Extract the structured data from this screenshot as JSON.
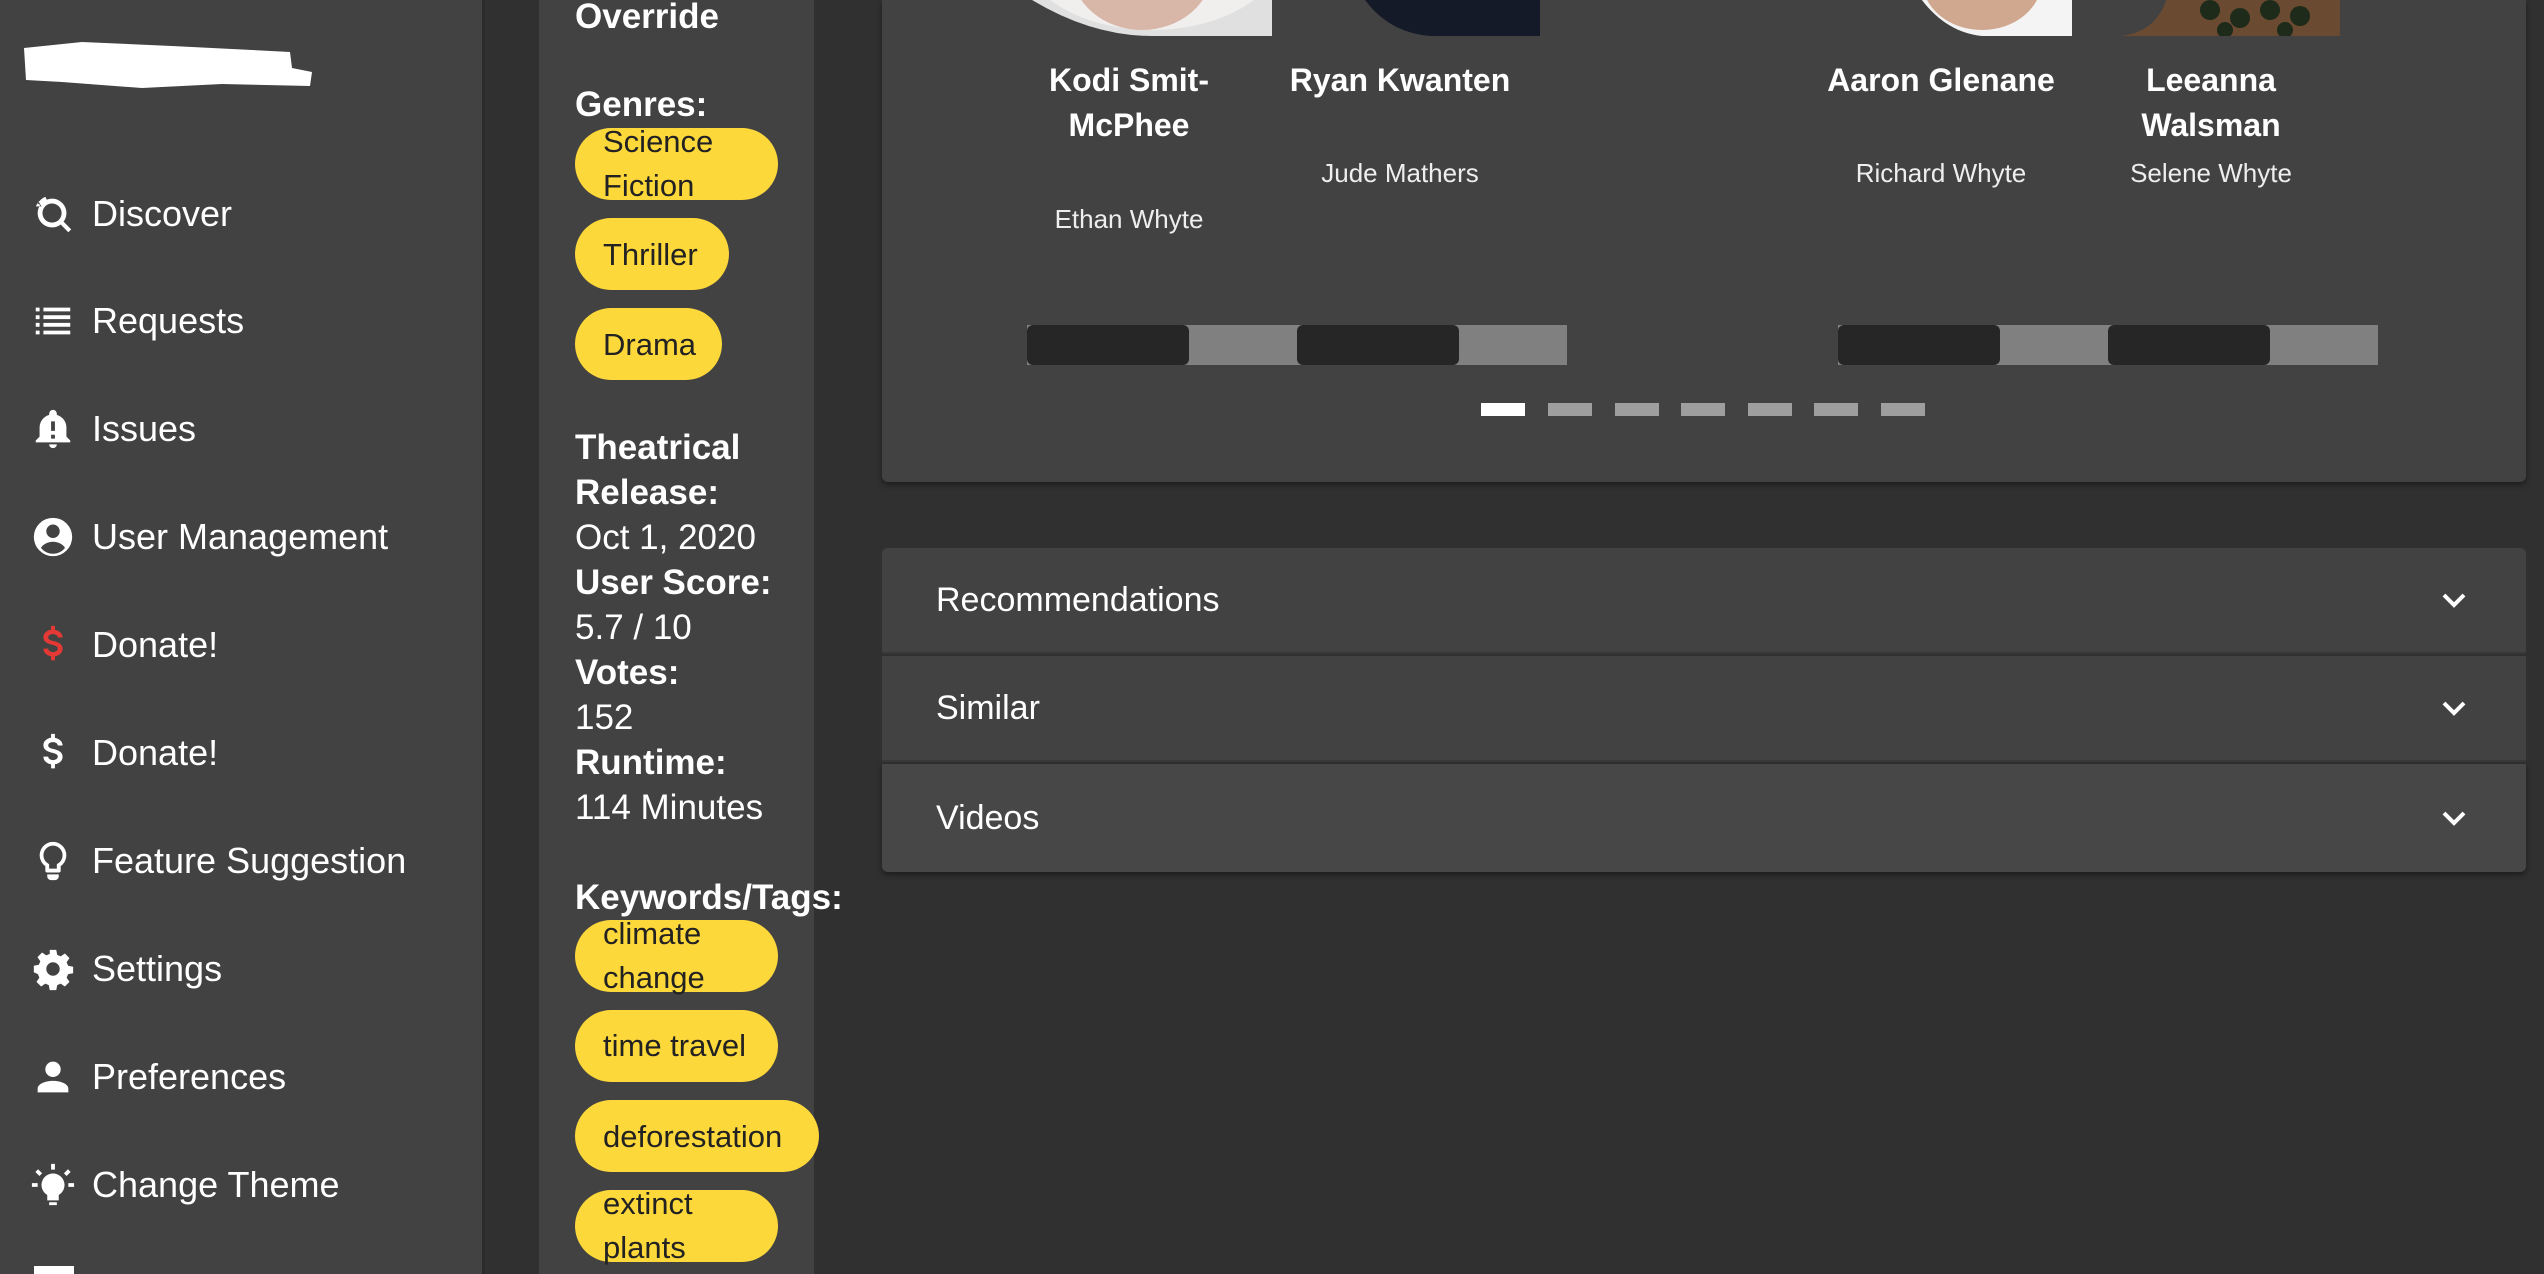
{
  "sidebar": {
    "items": [
      {
        "label": "Discover",
        "icon": "discover-icon"
      },
      {
        "label": "Requests",
        "icon": "list-icon"
      },
      {
        "label": "Issues",
        "icon": "bell-alert-icon"
      },
      {
        "label": "User Management",
        "icon": "account-circle-icon"
      },
      {
        "label": "Donate!",
        "icon": "dollar-icon",
        "color": "#e53935"
      },
      {
        "label": "Donate!",
        "icon": "dollar-icon",
        "color": "#ffffff"
      },
      {
        "label": "Feature Suggestion",
        "icon": "lightbulb-icon"
      },
      {
        "label": "Settings",
        "icon": "gear-icon"
      },
      {
        "label": "Preferences",
        "icon": "person-icon"
      },
      {
        "label": "Change Theme",
        "icon": "theme-icon"
      }
    ]
  },
  "info": {
    "override_label": "Override",
    "genres_label": "Genres:",
    "genres": [
      "Science Fiction",
      "Thriller",
      "Drama"
    ],
    "release_label": "Theatrical Release:",
    "release_value": "Oct 1, 2020",
    "score_label": "User Score:",
    "score_value": "5.7 / 10",
    "votes_label": "Votes:",
    "votes_value": "152",
    "runtime_label": "Runtime:",
    "runtime_value": "114 Minutes",
    "keywords_label": "Keywords/Tags:",
    "keywords": [
      "climate change",
      "time travel",
      "deforestation",
      "extinct plants"
    ]
  },
  "cast": [
    {
      "name": "Kodi Smit-McPhee",
      "role": "Ethan Whyte"
    },
    {
      "name": "Ryan Kwanten",
      "role": "Jude Mathers"
    },
    {
      "name": "Aaron Glenane",
      "role": "Richard Whyte"
    },
    {
      "name": "Leeanna Walsman",
      "role": "Selene Whyte"
    }
  ],
  "carousel": {
    "page_count": 7,
    "active_page": 1
  },
  "sections": {
    "recommendations": "Recommendations",
    "similar": "Similar",
    "videos": "Videos"
  },
  "colors": {
    "chip": "#fdd83a",
    "panel": "#424242",
    "background": "#303030",
    "donate_accent": "#e53935"
  }
}
